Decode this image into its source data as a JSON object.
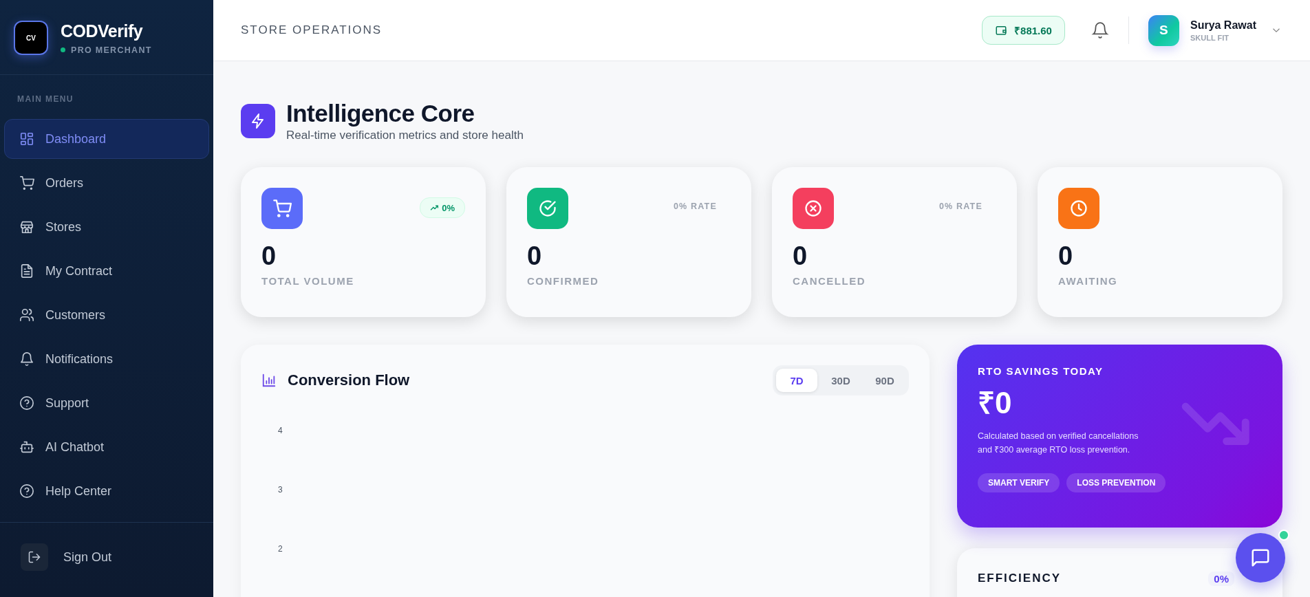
{
  "brand": {
    "name": "CODVerify",
    "tier": "PRO MERCHANT",
    "logo_text": "CV"
  },
  "sidebar": {
    "section": "MAIN MENU",
    "items": [
      {
        "label": "Dashboard",
        "selected": true
      },
      {
        "label": "Orders",
        "selected": false
      },
      {
        "label": "Stores",
        "selected": false
      },
      {
        "label": "My Contract",
        "selected": false
      },
      {
        "label": "Customers",
        "selected": false
      },
      {
        "label": "Notifications",
        "selected": false
      },
      {
        "label": "Support",
        "selected": false
      },
      {
        "label": "AI Chatbot",
        "selected": false
      },
      {
        "label": "Help Center",
        "selected": false
      }
    ],
    "sign_out": "Sign Out"
  },
  "header": {
    "title": "STORE OPERATIONS",
    "balance": "₹881.60",
    "user": {
      "initial": "S",
      "name": "Surya Rawat",
      "store": "SKULL FIT"
    }
  },
  "page": {
    "title": "Intelligence Core",
    "subtitle": "Real-time verification metrics and store health"
  },
  "stats": [
    {
      "value": "0",
      "label": "TOTAL VOLUME",
      "color": "#5b6cf9",
      "badge": {
        "kind": "trend",
        "text": "0%"
      }
    },
    {
      "value": "0",
      "label": "CONFIRMED",
      "color": "#10b981",
      "badge": {
        "kind": "rate",
        "text": "0% RATE"
      }
    },
    {
      "value": "0",
      "label": "CANCELLED",
      "color": "#f43f5e",
      "badge": {
        "kind": "rate",
        "text": "0% RATE"
      }
    },
    {
      "value": "0",
      "label": "AWAITING",
      "color": "#f97316"
    }
  ],
  "conversion": {
    "title": "Conversion Flow",
    "ranges": [
      {
        "label": "7D",
        "selected": true
      },
      {
        "label": "30D",
        "selected": false
      },
      {
        "label": "90D",
        "selected": false
      }
    ],
    "y_axis_labels": [
      "4",
      "3",
      "2"
    ]
  },
  "savings": {
    "title": "RTO SAVINGS TODAY",
    "amount": "₹0",
    "note": "Calculated based on verified cancellations and ₹300 average RTO loss prevention.",
    "tags": [
      "SMART VERIFY",
      "LOSS PREVENTION"
    ]
  },
  "efficiency": {
    "title": "EFFICIENCY",
    "value": "0%"
  }
}
